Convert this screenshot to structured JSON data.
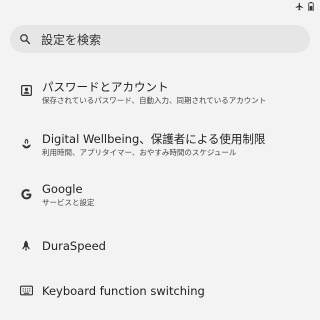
{
  "status_bar": {
    "icons": [
      "airplane-icon",
      "battery-icon"
    ]
  },
  "search": {
    "placeholder": "設定を検索"
  },
  "settings": [
    {
      "icon": "account-box-icon",
      "title": "パスワードとアカウント",
      "subtitle": "保存されているパスワード、自動入力、同期されているアカウント"
    },
    {
      "icon": "wellbeing-icon",
      "title": "Digital Wellbeing、保護者による使用制限",
      "subtitle": "利用時間、アプリタイマー、おやすみ時間のスケジュール"
    },
    {
      "icon": "google-g-icon",
      "title": "Google",
      "subtitle": "サービスと設定"
    },
    {
      "icon": "rocket-icon",
      "title": "DuraSpeed",
      "subtitle": ""
    },
    {
      "icon": "keyboard-icon",
      "title": "Keyboard function switching",
      "subtitle": ""
    }
  ],
  "colors": {
    "background": "#f3f3f3",
    "search_bg": "#e6e6e6",
    "text_primary": "#1f1f1f",
    "text_secondary": "#444444"
  }
}
